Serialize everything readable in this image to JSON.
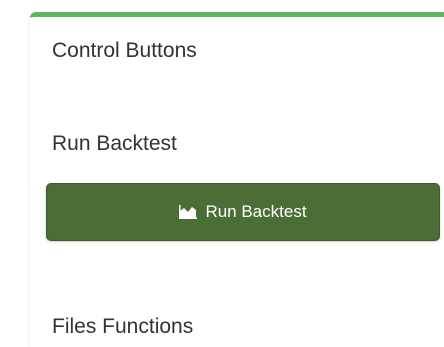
{
  "panel": {
    "title": "Control Buttons",
    "accent_color": "#5cb85c"
  },
  "sections": {
    "run_backtest": {
      "heading": "Run Backtest",
      "button": {
        "label": "Run Backtest",
        "icon": "area-chart-icon",
        "color": "#4a6e35"
      }
    },
    "files_functions": {
      "heading": "Files Functions"
    }
  }
}
